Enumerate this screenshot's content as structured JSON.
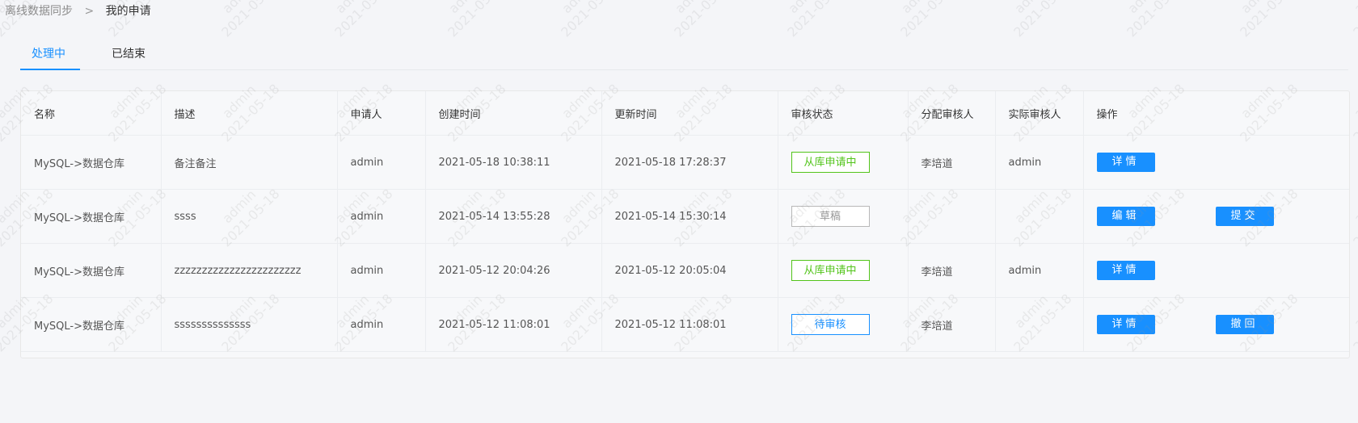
{
  "breadcrumb": {
    "parent": "离线数据同步",
    "separator": ">",
    "current": "我的申请"
  },
  "tabs": [
    {
      "label": "处理中",
      "active": true
    },
    {
      "label": "已结束",
      "active": false
    }
  ],
  "table": {
    "columns": [
      "名称",
      "描述",
      "申请人",
      "创建时间",
      "更新时间",
      "审核状态",
      "分配审核人",
      "实际审核人",
      "操作"
    ],
    "rows": [
      {
        "name": "MySQL->数据仓库",
        "desc": "备注备注",
        "applicant": "admin",
        "created": "2021-05-18 10:38:11",
        "updated": "2021-05-18 17:28:37",
        "status": "从库申请中",
        "status_color": "#52c41a",
        "assigned": "李培道",
        "actual": "admin",
        "actions": [
          "详情"
        ]
      },
      {
        "name": "MySQL->数据仓库",
        "desc": "ssss",
        "applicant": "admin",
        "created": "2021-05-14 13:55:28",
        "updated": "2021-05-14 15:30:14",
        "status": "草稿",
        "status_color": "#999999",
        "assigned": "",
        "actual": "",
        "actions": [
          "编辑",
          "提交"
        ]
      },
      {
        "name": "MySQL->数据仓库",
        "desc": "zzzzzzzzzzzzzzzzzzzzzzz",
        "applicant": "admin",
        "created": "2021-05-12 20:04:26",
        "updated": "2021-05-12 20:05:04",
        "status": "从库申请中",
        "status_color": "#52c41a",
        "assigned": "李培道",
        "actual": "admin",
        "actions": [
          "详情"
        ]
      },
      {
        "name": "MySQL->数据仓库",
        "desc": "ssssssssssssss",
        "applicant": "admin",
        "created": "2021-05-12 11:08:01",
        "updated": "2021-05-12 11:08:01",
        "status": "待审核",
        "status_color": "#1890ff",
        "assigned": "李培道",
        "actual": "",
        "actions": [
          "详情",
          "撤回"
        ]
      }
    ]
  },
  "watermark": {
    "line1": "admin",
    "line2": "2021-05-18"
  },
  "colors": {
    "primary": "#1890ff",
    "success": "#52c41a",
    "muted": "#999999",
    "background": "#f4f5f8"
  }
}
